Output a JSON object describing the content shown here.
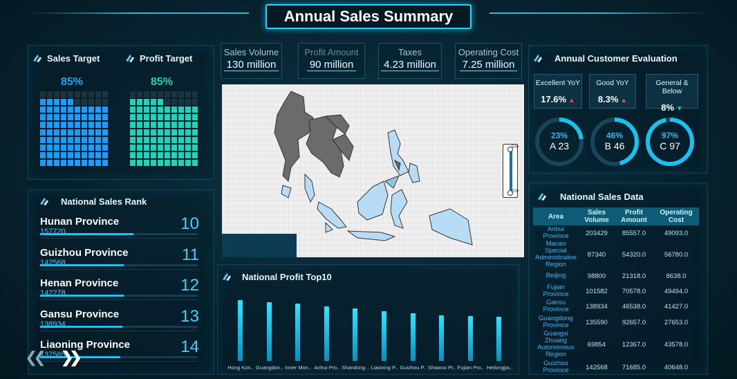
{
  "header": {
    "title": "Annual Sales Summary"
  },
  "targets": {
    "sales": {
      "label": "Sales Target",
      "percent_text": "85%",
      "fraction": 0.85
    },
    "profit": {
      "label": "Profit Target",
      "percent_text": "85%",
      "fraction": 0.85
    },
    "colors": {
      "sales": "#1e9bff",
      "profit": "#1fd3b8",
      "empty": "#1c3340"
    }
  },
  "kpis": [
    {
      "label": "Sales Volume",
      "value": "130 million"
    },
    {
      "label": "Profit Amount",
      "value": "90 million"
    },
    {
      "label": "Taxes",
      "value": "4.23 million"
    },
    {
      "label": "Operating Cost",
      "value": "7.25 million"
    }
  ],
  "map": {
    "legend_max": "500",
    "legend_min": "200"
  },
  "rank": {
    "title": "National Sales Rank",
    "items": [
      {
        "name": "Hunan Province",
        "value": "157720",
        "rank": "10",
        "fraction": 0.59
      },
      {
        "name": "Guizhou Province",
        "value": "142568",
        "rank": "11",
        "fraction": 0.53
      },
      {
        "name": "Henan Province",
        "value": "142278",
        "rank": "12",
        "fraction": 0.53
      },
      {
        "name": "Gansu Province",
        "value": "138934",
        "rank": "13",
        "fraction": 0.52
      },
      {
        "name": "Liaoning Province",
        "value": "137565",
        "rank": "14",
        "fraction": 0.51
      }
    ]
  },
  "evaluation": {
    "title": "Annual Customer Evaluation",
    "boxes": [
      {
        "label": "Excellent YoY",
        "value": "17.6%",
        "trend": "up"
      },
      {
        "label": "Good YoY",
        "value": "8.3%",
        "trend": "up"
      },
      {
        "label": "General & Below",
        "value": "8%",
        "trend": "down"
      }
    ],
    "rings": [
      {
        "percent_text": "23%",
        "label": "A 23",
        "fraction": 0.23
      },
      {
        "percent_text": "46%",
        "label": "B 46",
        "fraction": 0.46
      },
      {
        "percent_text": "97%",
        "label": "C 97",
        "fraction": 0.97
      }
    ]
  },
  "sales_table": {
    "title": "National Sales Data",
    "headers": [
      "Area",
      "Sales Volume",
      "Profit Amount",
      "Operating Cost"
    ],
    "rows": [
      [
        "Anhui Province",
        "203429",
        "85557.0",
        "49093.0"
      ],
      [
        "Macao Special Administrative Region",
        "87340",
        "54320.0",
        "56780.0"
      ],
      [
        "Beijing",
        "98800",
        "21318.0",
        "8638.0"
      ],
      [
        "Fujian Province",
        "101582",
        "70578.0",
        "49494.0"
      ],
      [
        "Gansu Province",
        "138934",
        "46538.0",
        "41427.0"
      ],
      [
        "Guangdong Province",
        "135590",
        "92657.0",
        "27653.0"
      ],
      [
        "Guangxi Zhuang Autonomous Region",
        "69854",
        "12367.0",
        "43578.0"
      ],
      [
        "Guizhou Province",
        "142568",
        "71685.0",
        "40648.0"
      ]
    ]
  },
  "profit_top10": {
    "title": "National Profit Top10"
  },
  "chart_data": {
    "type": "bar",
    "title": "National Profit Top10",
    "categories": [
      "Hong Kon..",
      "Guangdon..",
      "Inner Mon..",
      "Anhui Pro..",
      "Shandong ..",
      "Liaoning P..",
      "Guizhou P..",
      "Shaanxi Pr..",
      "Fujian Pro..",
      "Heilongjia.."
    ],
    "values": [
      100,
      97,
      94,
      90,
      86,
      82,
      78,
      75,
      74,
      73
    ],
    "ylim": [
      0,
      100
    ],
    "grid": false
  }
}
